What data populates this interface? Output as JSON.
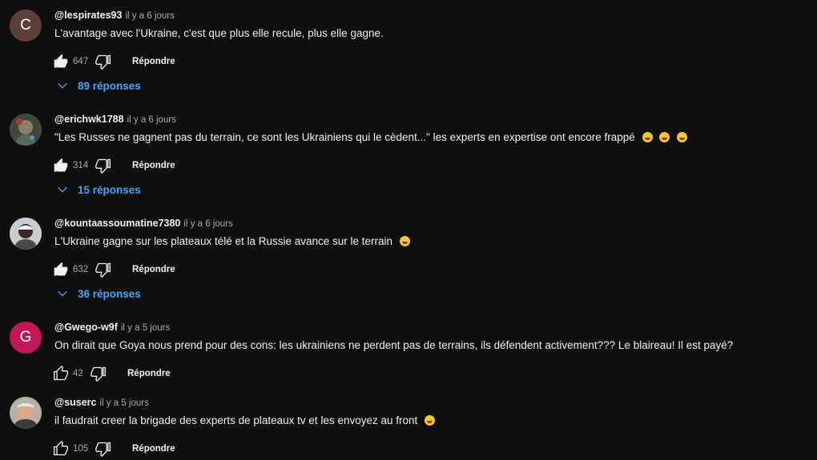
{
  "comments": [
    {
      "author": "@lespirates93",
      "time": "il y a 6 jours",
      "text": "L'avantage avec l'Ukraine, c'est que plus elle recule, plus elle gagne.",
      "likes": "647",
      "reply_label": "Répondre",
      "replies_label": "89 réponses",
      "avatar_letter": "C",
      "avatar_color": "#5d4037",
      "liked": true,
      "emoji_count": 0
    },
    {
      "author": "@erichwk1788",
      "time": "il y a 6 jours",
      "text": "\"Les Russes ne gagnent pas du terrain, ce sont les Ukrainiens qui le cèdent...\" les experts en expertise ont encore frappé",
      "likes": "314",
      "reply_label": "Répondre",
      "replies_label": "15 réponses",
      "avatar_letter": "",
      "avatar_color": "#4a4a4a",
      "liked": true,
      "emoji_count": 3
    },
    {
      "author": "@kountaassoumatine7380",
      "time": "il y a 6 jours",
      "text": "L'Ukraine gagne sur les plateaux télé et la Russie avance sur le terrain",
      "likes": "632",
      "reply_label": "Répondre",
      "replies_label": "36 réponses",
      "avatar_letter": "",
      "avatar_color": "#8a8a8a",
      "liked": true,
      "emoji_count": 1
    },
    {
      "author": "@Gwego-w9f",
      "time": "il y a 5 jours",
      "text": "On dirait que Goya nous prend pour des cons: les ukrainiens ne perdent pas de terrains, ils défendent activement??? Le blaireau! Il est payé?",
      "likes": "42",
      "reply_label": "Répondre",
      "replies_label": "",
      "avatar_letter": "G",
      "avatar_color": "#c2185b",
      "liked": false,
      "emoji_count": 0
    },
    {
      "author": "@suserc",
      "time": "il y a 5 jours",
      "text": "il faudrait creer la brigade des experts de plateaux tv et les envoyez au front",
      "likes": "105",
      "reply_label": "Répondre",
      "replies_label": "",
      "avatar_letter": "",
      "avatar_color": "#9c8f80",
      "liked": false,
      "emoji_count": 1
    }
  ],
  "colors": {
    "background": "#0f0f0f",
    "text_primary": "#f1f1f1",
    "text_secondary": "#aaaaaa",
    "link_blue": "#3ea6ff"
  },
  "icons": {
    "like": "thumb-up-icon",
    "dislike": "thumb-down-icon",
    "expand": "chevron-down-icon"
  }
}
